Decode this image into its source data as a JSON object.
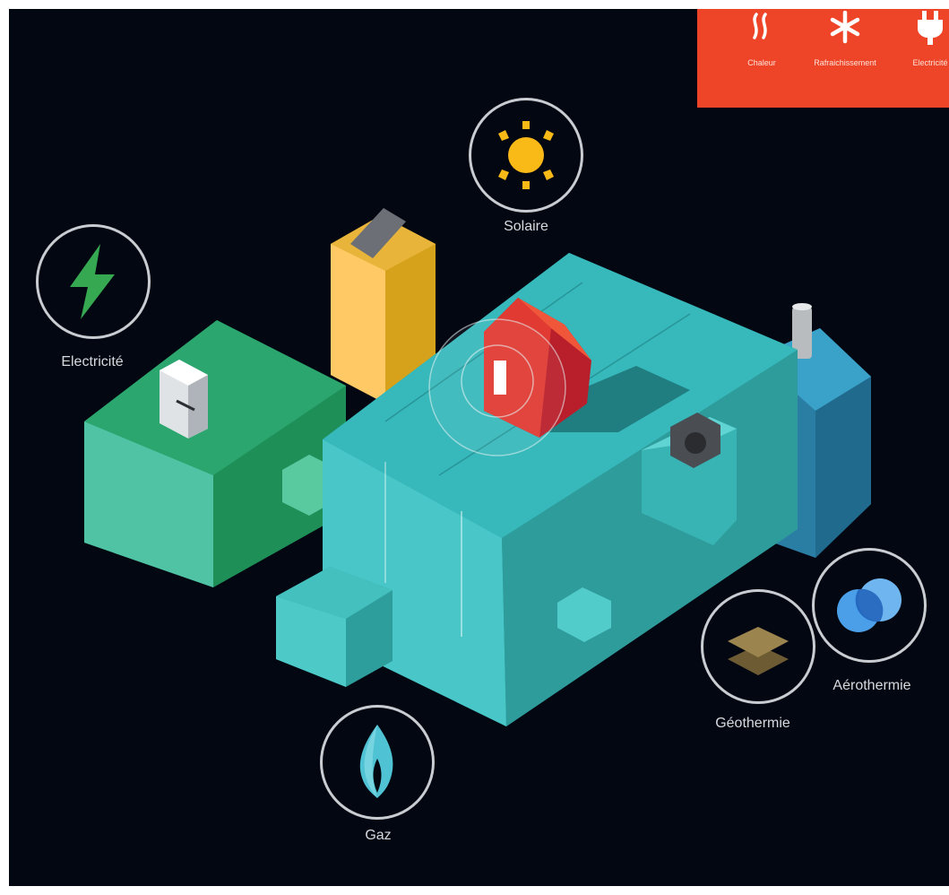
{
  "menu": {
    "items": [
      {
        "label": "Chaleur",
        "icon": "heat-waves-icon"
      },
      {
        "label": "Rafraichissement",
        "icon": "snowflake-icon"
      },
      {
        "label": "Electricité",
        "icon": "plug-icon"
      }
    ],
    "color": "#ee4427"
  },
  "sources": {
    "solaire": {
      "label": "Solaire",
      "icon": "sun-icon",
      "color": "#f9b917"
    },
    "electricite": {
      "label": "Electricité",
      "icon": "lightning-icon",
      "color": "#36a852"
    },
    "gaz": {
      "label": "Gaz",
      "icon": "flame-icon",
      "color": "#4fc3d3"
    },
    "geothermie": {
      "label": "Géothermie",
      "icon": "ground-layers-icon",
      "color": "#9c844f"
    },
    "aerothermie": {
      "label": "Aérothermie",
      "icon": "air-circles-icon",
      "color": "#3f8fdc"
    }
  },
  "colors": {
    "background": "#030712",
    "house": "#d92a2a",
    "building": "#47c5c8"
  }
}
